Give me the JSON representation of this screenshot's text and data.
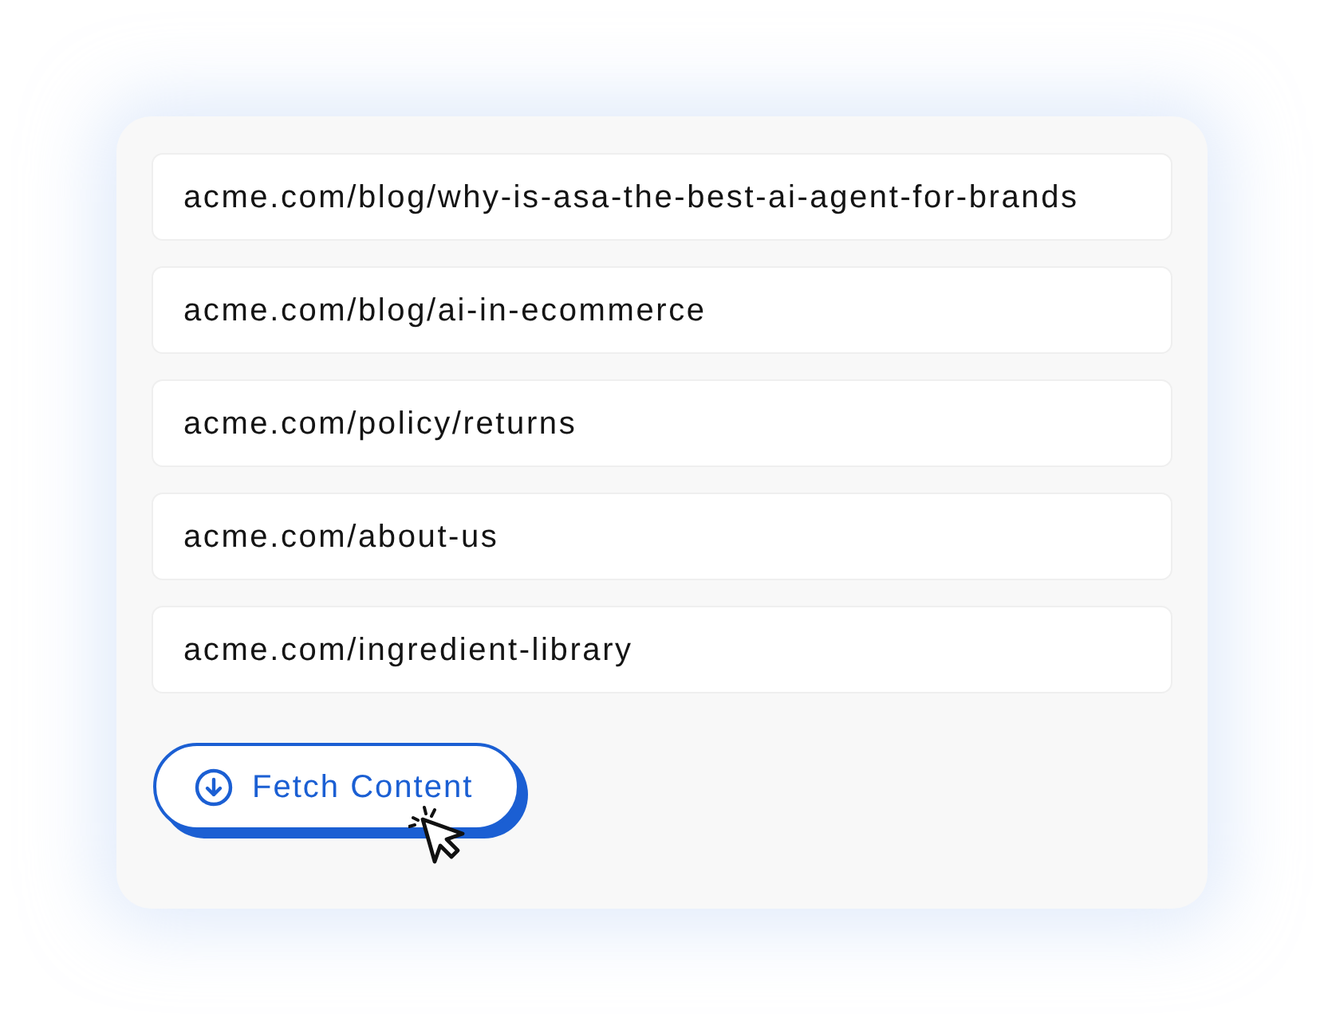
{
  "urls": [
    {
      "value": "acme.com/blog/why-is-asa-the-best-ai-agent-for-brands"
    },
    {
      "value": "acme.com/blog/ai-in-ecommerce"
    },
    {
      "value": "acme.com/policy/returns"
    },
    {
      "value": "acme.com/about-us"
    },
    {
      "value": "acme.com/ingredient-library"
    }
  ],
  "button": {
    "label": "Fetch Content"
  }
}
